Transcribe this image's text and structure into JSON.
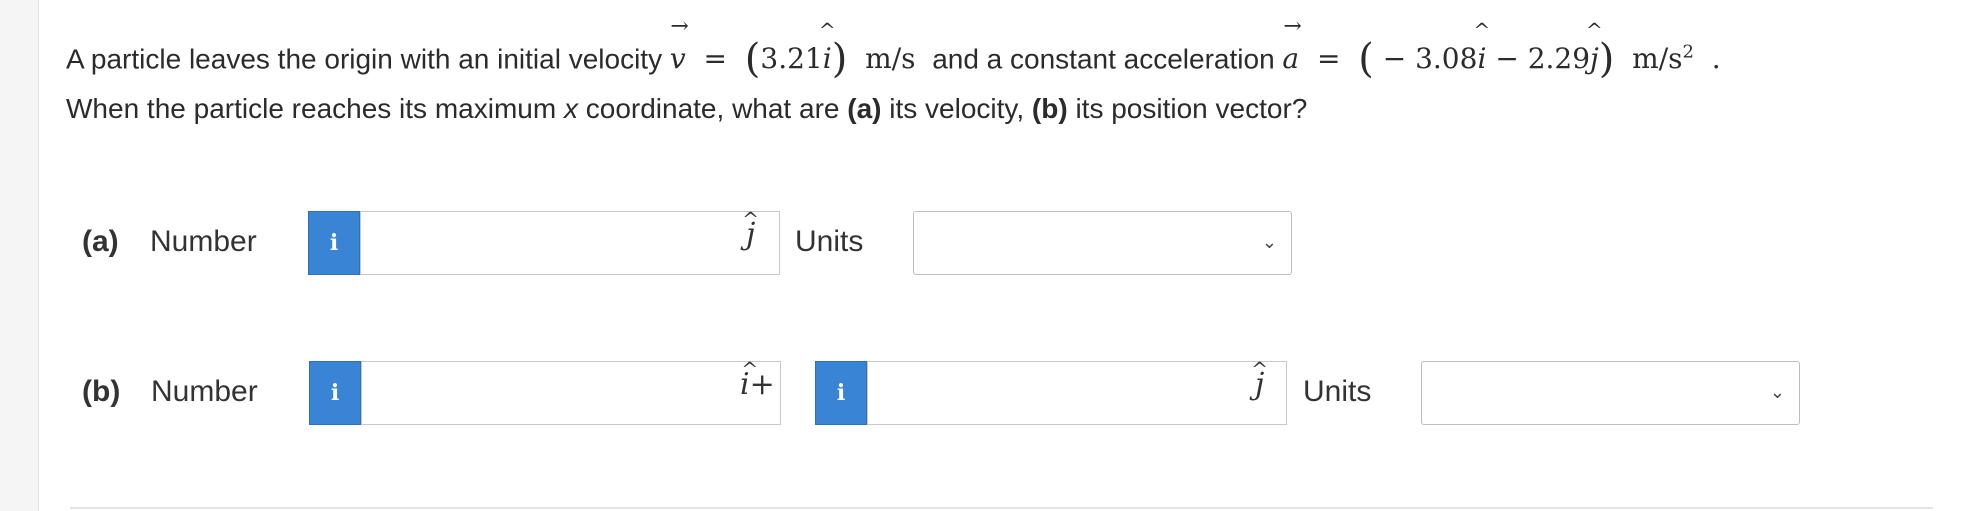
{
  "question": {
    "intro": "A particle leaves the origin with an initial velocity",
    "v_symbol": "v",
    "equals": "=",
    "v_value": "3.21",
    "v_unit_vector": "i",
    "v_units": "m/s",
    "mid_text": "and a constant acceleration",
    "a_symbol": "a",
    "a_value_prefix": "− 3.08",
    "a_i": "i",
    "a_minus": "− 2.29",
    "a_j": "j",
    "a_units": "m/s",
    "a_units_exp": "2",
    "period": ".",
    "line2_prefix": "When the particle reaches its maximum",
    "line2_x": "x",
    "line2_mid": "coordinate, what are",
    "part_a_tag": "(a)",
    "part_a_text": "its velocity,",
    "part_b_tag": "(b)",
    "part_b_text": "its position vector?"
  },
  "part_a": {
    "label": "(a)",
    "field_label": "Number",
    "info_icon": "i",
    "input_value": "",
    "unit_vector": "j",
    "units_label": "Units",
    "units_selected": ""
  },
  "part_b": {
    "label": "(b)",
    "field_label": "Number",
    "info_icon_1": "i",
    "input_value_1": "",
    "unit_vector_1": "i+",
    "info_icon_2": "i",
    "input_value_2": "",
    "unit_vector_2": "j",
    "units_label": "Units",
    "units_selected": ""
  },
  "icons": {
    "info": "info-icon",
    "dropdown": "chevron-down-icon"
  },
  "colors": {
    "info_button": "#3a84d6",
    "text": "#2b2b2b"
  }
}
